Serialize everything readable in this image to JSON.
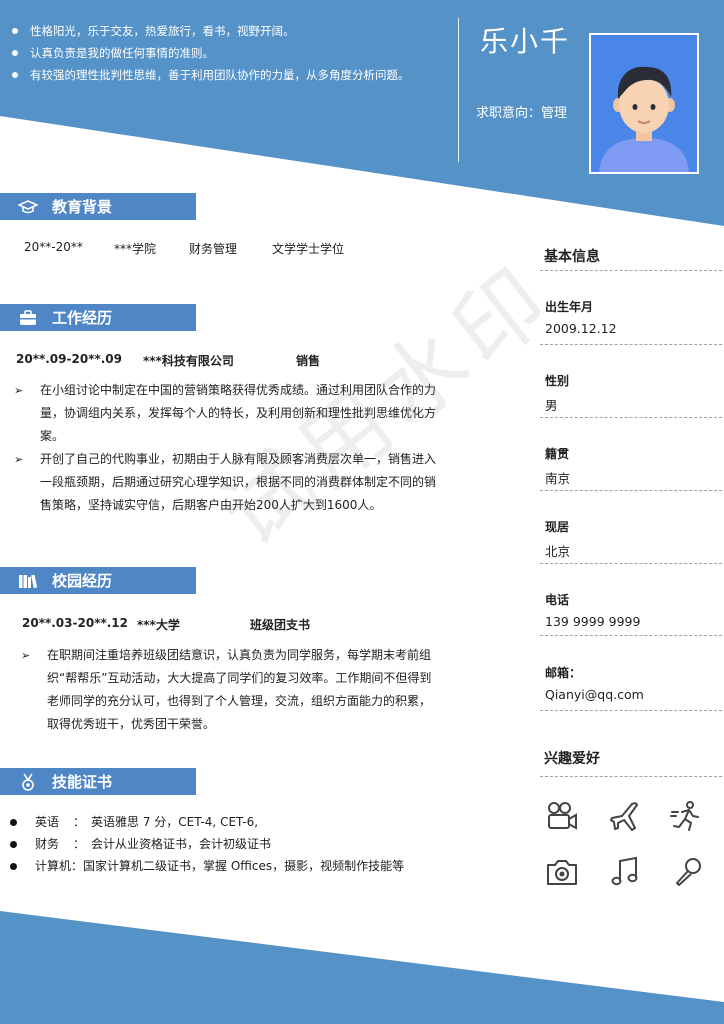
{
  "header": {
    "intro": [
      "性格阳光，乐于交友，热爱旅行，看书，视野开阔。",
      "认真负责是我的做任何事情的准则。",
      "有较强的理性批判性思维，善于利用团队协作的力量，从多角度分析问题。"
    ],
    "name": "乐小千",
    "intent": "求职意向：管理"
  },
  "education": {
    "title": "教育背景",
    "period": "20**-20**",
    "school": "***学院",
    "major": "财务管理",
    "degree": "文学学士学位"
  },
  "work": {
    "title": "工作经历",
    "period": "20**.09-20**.09",
    "company": "***科技有限公司",
    "role": "销售",
    "items": [
      "在小组讨论中制定在中国的营销策略获得优秀成绩。通过利用团队合作的力量，协调组内关系，发挥每个人的特长，及利用创新和理性批判思维优化方案。",
      "开创了自己的代购事业，初期由于人脉有限及顾客消费层次单一，销售进入一段瓶颈期，后期通过研究心理学知识，根据不同的消费群体制定不同的销售策略，坚持诚实守信，后期客户由开始200人扩大到1600人。"
    ]
  },
  "campus": {
    "title": "校园经历",
    "period": "20**.03-20**.12",
    "school": "***大学",
    "role": "班级团支书",
    "items": [
      "在职期间注重培养班级团结意识，认真负责为同学服务，每学期末考前组织“帮帮乐”互动活动，大大提高了同学们的复习效率。工作期间不但得到老师同学的充分认可，也得到了个人管理，交流，组织方面能力的积累，取得优秀班干，优秀团干荣誉。"
    ]
  },
  "skills": {
    "title": "技能证书",
    "items": [
      {
        "label": "英语",
        "sep": "：",
        "text": "英语雅思 7 分，CET-4, CET-6,"
      },
      {
        "label": "财务",
        "sep": "：",
        "text": "会计从业资格证书，会计初级证书"
      },
      {
        "label": "计算机",
        "sep": "：",
        "text": "国家计算机二级证书，掌握 Offices，摄影，视频制作技能等"
      }
    ]
  },
  "basic_info": {
    "title": "基本信息",
    "fields": [
      {
        "label": "出生年月",
        "value": "2009.12.12"
      },
      {
        "label": "性别",
        "value": "男"
      },
      {
        "label": "籍贯",
        "value": "南京"
      },
      {
        "label": "现居",
        "value": "北京"
      },
      {
        "label": "电话",
        "value": "139 9999 9999"
      },
      {
        "label": "邮箱：",
        "value": "Qianyi@qq.com"
      }
    ]
  },
  "hobbies": {
    "title": "兴趣爱好",
    "icons": [
      "camera-video-icon",
      "airplane-icon",
      "running-icon",
      "photo-camera-icon",
      "music-note-icon",
      "microphone-icon"
    ]
  },
  "watermark": "试用水印",
  "colors": {
    "accent": "#4e86c6",
    "band": "#5592c8",
    "photo_bg": "#4a86e8"
  }
}
